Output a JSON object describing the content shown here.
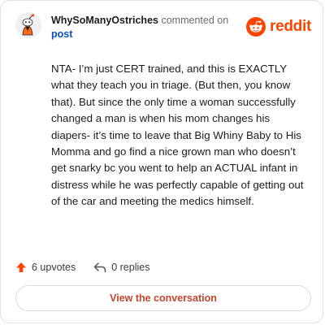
{
  "comment": {
    "username": "WhySoManyOstriches",
    "action_text": "commented on",
    "post_label": "post",
    "body": "NTA- I’m just CERT trained, and this is EXACTLY what they teach you in triage. (But then, you know that). But since the only time a woman successfully changed a man is when his mom changes his diapers- it’s time to leave that Big Whiny Baby to His Momma and go find a nice grown man who doesn’t get snarky bc you went to help an ACTUAL infant in distress while he was perfectly capable of getting out of the car and meeting the medics himself."
  },
  "brand": {
    "wordmark": "reddit",
    "color": "#ff4500"
  },
  "actions": {
    "upvotes_label": "6 upvotes",
    "replies_label": "0 replies"
  },
  "footer": {
    "view_button_label": "View the conversation"
  },
  "icons": {
    "upvote": "upvote-arrow-icon",
    "reply": "reply-arrow-icon",
    "logo": "reddit-snoo-icon",
    "avatar": "user-avatar"
  }
}
